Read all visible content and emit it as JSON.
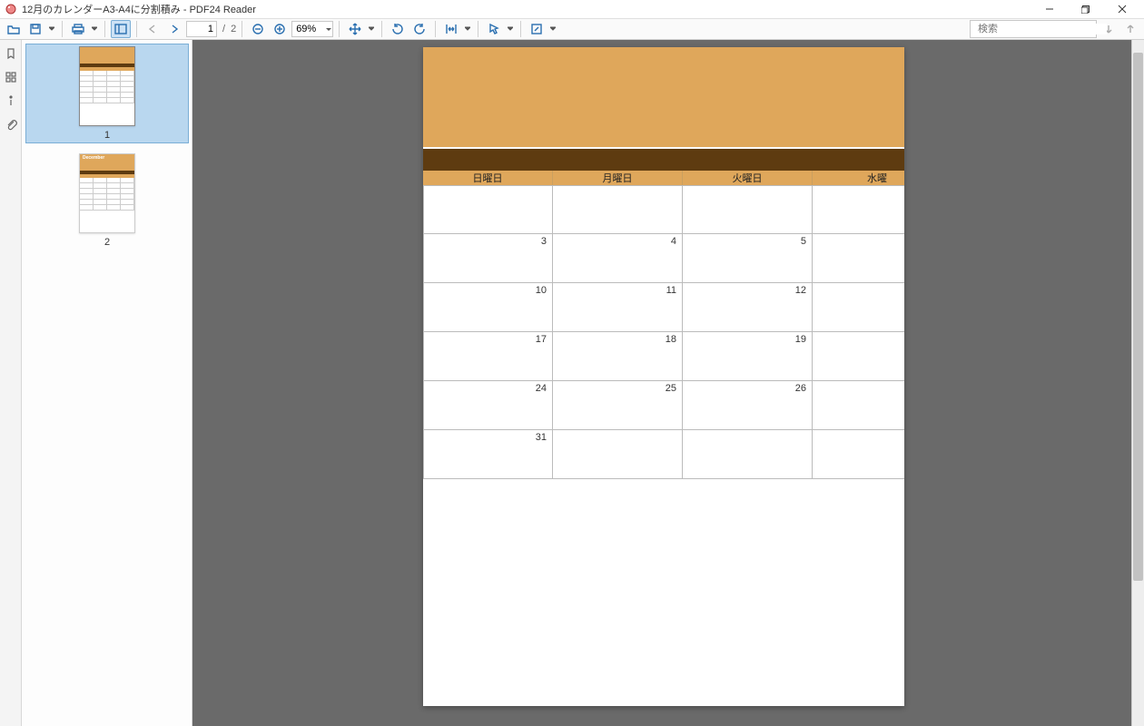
{
  "window": {
    "title": "12月のカレンダーA3-A4に分割積み - PDF24 Reader"
  },
  "toolbar": {
    "page_current": "1",
    "page_total": "2",
    "zoom": "69%"
  },
  "search": {
    "placeholder": "検索"
  },
  "thumbnails": [
    {
      "num": "1",
      "selected": true
    },
    {
      "num": "2",
      "selected": false,
      "title": "December"
    }
  ],
  "calendar": {
    "day_headers": [
      "日曜日",
      "月曜日",
      "火曜日",
      "水曜"
    ],
    "rows": [
      [
        "",
        "",
        "",
        ""
      ],
      [
        "3",
        "4",
        "5",
        ""
      ],
      [
        "10",
        "11",
        "12",
        ""
      ],
      [
        "17",
        "18",
        "19",
        ""
      ],
      [
        "24",
        "25",
        "26",
        ""
      ],
      [
        "31",
        "",
        "",
        ""
      ]
    ]
  }
}
